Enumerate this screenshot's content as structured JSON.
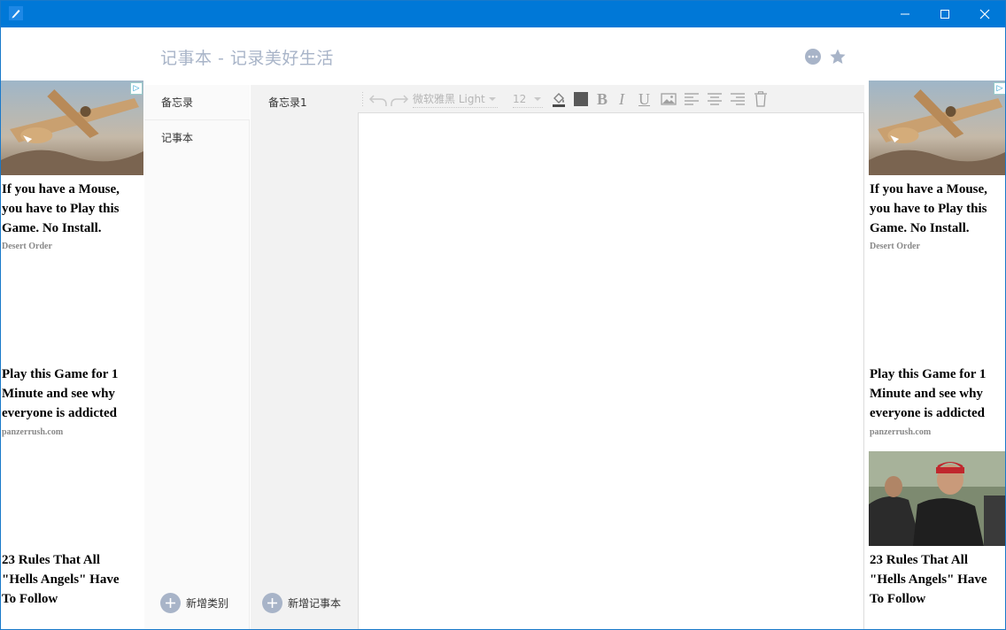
{
  "window": {
    "title_icon": "pen-icon",
    "controls": [
      "minimize-icon",
      "maximize-icon",
      "close-icon"
    ]
  },
  "header": {
    "title": "记事本 - 记录美好生活",
    "icons": [
      "more-icon",
      "star-icon"
    ]
  },
  "categories": {
    "items": [
      {
        "label": "备忘录"
      },
      {
        "label": "记事本"
      }
    ],
    "add_label": "新增类别"
  },
  "notes": {
    "items": [
      {
        "label": "备忘录1"
      }
    ],
    "add_label": "新增记事本"
  },
  "toolbar": {
    "font": "微软雅黑 Light",
    "size": "12",
    "bold": "B",
    "italic": "I",
    "underline": "U",
    "icons": [
      "undo-icon",
      "redo-icon",
      "fill-color-icon",
      "text-color-swatch",
      "bold-icon",
      "italic-icon",
      "underline-icon",
      "image-icon",
      "align-left-icon",
      "align-center-icon",
      "align-right-icon",
      "delete-icon"
    ]
  },
  "ads": {
    "left": [
      {
        "headline": "If you have a Mouse, you have to Play this Game. No Install.",
        "source": "Desert Order"
      },
      {
        "headline": "Play this Game for 1 Minute and see why everyone is addicted",
        "source": "panzerrush.com"
      },
      {
        "headline": "23 Rules That All \"Hells Angels\" Have To Follow",
        "source": ""
      }
    ],
    "right": [
      {
        "headline": "If you have a Mouse, you have to Play this Game. No Install.",
        "source": "Desert Order"
      },
      {
        "headline": "Play this Game for 1 Minute and see why everyone is addicted",
        "source": "panzerrush.com"
      },
      {
        "headline": "23 Rules That All \"Hells Angels\" Have To Follow",
        "source": ""
      }
    ],
    "adchoices": "▷"
  },
  "colors": {
    "titlebar": "#0078d7",
    "accent": "#a8b4c8"
  }
}
